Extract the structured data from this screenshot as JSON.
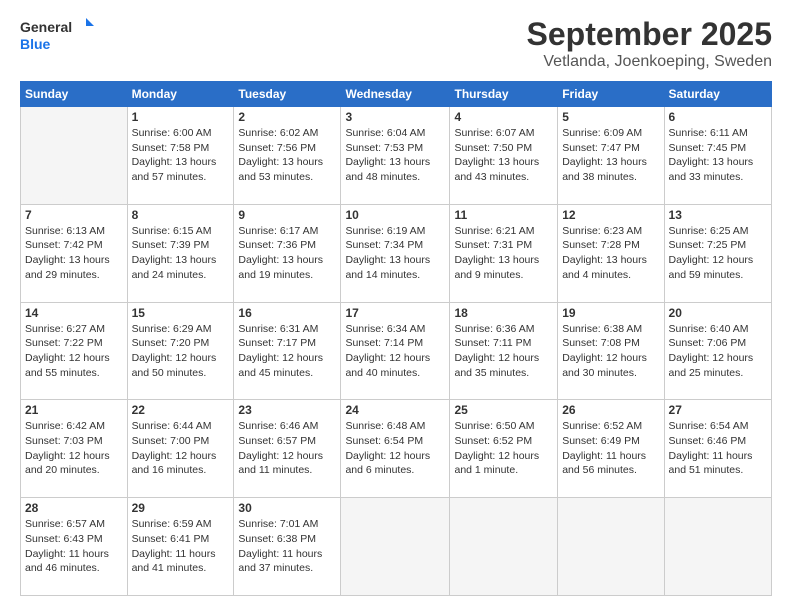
{
  "logo": {
    "line1": "General",
    "line2": "Blue"
  },
  "title": "September 2025",
  "subtitle": "Vetlanda, Joenkoeping, Sweden",
  "days_header": [
    "Sunday",
    "Monday",
    "Tuesday",
    "Wednesday",
    "Thursday",
    "Friday",
    "Saturday"
  ],
  "weeks": [
    [
      {
        "day": "",
        "sunrise": "",
        "sunset": "",
        "daylight": ""
      },
      {
        "day": "1",
        "sunrise": "Sunrise: 6:00 AM",
        "sunset": "Sunset: 7:58 PM",
        "daylight": "Daylight: 13 hours and 57 minutes."
      },
      {
        "day": "2",
        "sunrise": "Sunrise: 6:02 AM",
        "sunset": "Sunset: 7:56 PM",
        "daylight": "Daylight: 13 hours and 53 minutes."
      },
      {
        "day": "3",
        "sunrise": "Sunrise: 6:04 AM",
        "sunset": "Sunset: 7:53 PM",
        "daylight": "Daylight: 13 hours and 48 minutes."
      },
      {
        "day": "4",
        "sunrise": "Sunrise: 6:07 AM",
        "sunset": "Sunset: 7:50 PM",
        "daylight": "Daylight: 13 hours and 43 minutes."
      },
      {
        "day": "5",
        "sunrise": "Sunrise: 6:09 AM",
        "sunset": "Sunset: 7:47 PM",
        "daylight": "Daylight: 13 hours and 38 minutes."
      },
      {
        "day": "6",
        "sunrise": "Sunrise: 6:11 AM",
        "sunset": "Sunset: 7:45 PM",
        "daylight": "Daylight: 13 hours and 33 minutes."
      }
    ],
    [
      {
        "day": "7",
        "sunrise": "Sunrise: 6:13 AM",
        "sunset": "Sunset: 7:42 PM",
        "daylight": "Daylight: 13 hours and 29 minutes."
      },
      {
        "day": "8",
        "sunrise": "Sunrise: 6:15 AM",
        "sunset": "Sunset: 7:39 PM",
        "daylight": "Daylight: 13 hours and 24 minutes."
      },
      {
        "day": "9",
        "sunrise": "Sunrise: 6:17 AM",
        "sunset": "Sunset: 7:36 PM",
        "daylight": "Daylight: 13 hours and 19 minutes."
      },
      {
        "day": "10",
        "sunrise": "Sunrise: 6:19 AM",
        "sunset": "Sunset: 7:34 PM",
        "daylight": "Daylight: 13 hours and 14 minutes."
      },
      {
        "day": "11",
        "sunrise": "Sunrise: 6:21 AM",
        "sunset": "Sunset: 7:31 PM",
        "daylight": "Daylight: 13 hours and 9 minutes."
      },
      {
        "day": "12",
        "sunrise": "Sunrise: 6:23 AM",
        "sunset": "Sunset: 7:28 PM",
        "daylight": "Daylight: 13 hours and 4 minutes."
      },
      {
        "day": "13",
        "sunrise": "Sunrise: 6:25 AM",
        "sunset": "Sunset: 7:25 PM",
        "daylight": "Daylight: 12 hours and 59 minutes."
      }
    ],
    [
      {
        "day": "14",
        "sunrise": "Sunrise: 6:27 AM",
        "sunset": "Sunset: 7:22 PM",
        "daylight": "Daylight: 12 hours and 55 minutes."
      },
      {
        "day": "15",
        "sunrise": "Sunrise: 6:29 AM",
        "sunset": "Sunset: 7:20 PM",
        "daylight": "Daylight: 12 hours and 50 minutes."
      },
      {
        "day": "16",
        "sunrise": "Sunrise: 6:31 AM",
        "sunset": "Sunset: 7:17 PM",
        "daylight": "Daylight: 12 hours and 45 minutes."
      },
      {
        "day": "17",
        "sunrise": "Sunrise: 6:34 AM",
        "sunset": "Sunset: 7:14 PM",
        "daylight": "Daylight: 12 hours and 40 minutes."
      },
      {
        "day": "18",
        "sunrise": "Sunrise: 6:36 AM",
        "sunset": "Sunset: 7:11 PM",
        "daylight": "Daylight: 12 hours and 35 minutes."
      },
      {
        "day": "19",
        "sunrise": "Sunrise: 6:38 AM",
        "sunset": "Sunset: 7:08 PM",
        "daylight": "Daylight: 12 hours and 30 minutes."
      },
      {
        "day": "20",
        "sunrise": "Sunrise: 6:40 AM",
        "sunset": "Sunset: 7:06 PM",
        "daylight": "Daylight: 12 hours and 25 minutes."
      }
    ],
    [
      {
        "day": "21",
        "sunrise": "Sunrise: 6:42 AM",
        "sunset": "Sunset: 7:03 PM",
        "daylight": "Daylight: 12 hours and 20 minutes."
      },
      {
        "day": "22",
        "sunrise": "Sunrise: 6:44 AM",
        "sunset": "Sunset: 7:00 PM",
        "daylight": "Daylight: 12 hours and 16 minutes."
      },
      {
        "day": "23",
        "sunrise": "Sunrise: 6:46 AM",
        "sunset": "Sunset: 6:57 PM",
        "daylight": "Daylight: 12 hours and 11 minutes."
      },
      {
        "day": "24",
        "sunrise": "Sunrise: 6:48 AM",
        "sunset": "Sunset: 6:54 PM",
        "daylight": "Daylight: 12 hours and 6 minutes."
      },
      {
        "day": "25",
        "sunrise": "Sunrise: 6:50 AM",
        "sunset": "Sunset: 6:52 PM",
        "daylight": "Daylight: 12 hours and 1 minute."
      },
      {
        "day": "26",
        "sunrise": "Sunrise: 6:52 AM",
        "sunset": "Sunset: 6:49 PM",
        "daylight": "Daylight: 11 hours and 56 minutes."
      },
      {
        "day": "27",
        "sunrise": "Sunrise: 6:54 AM",
        "sunset": "Sunset: 6:46 PM",
        "daylight": "Daylight: 11 hours and 51 minutes."
      }
    ],
    [
      {
        "day": "28",
        "sunrise": "Sunrise: 6:57 AM",
        "sunset": "Sunset: 6:43 PM",
        "daylight": "Daylight: 11 hours and 46 minutes."
      },
      {
        "day": "29",
        "sunrise": "Sunrise: 6:59 AM",
        "sunset": "Sunset: 6:41 PM",
        "daylight": "Daylight: 11 hours and 41 minutes."
      },
      {
        "day": "30",
        "sunrise": "Sunrise: 7:01 AM",
        "sunset": "Sunset: 6:38 PM",
        "daylight": "Daylight: 11 hours and 37 minutes."
      },
      {
        "day": "",
        "sunrise": "",
        "sunset": "",
        "daylight": ""
      },
      {
        "day": "",
        "sunrise": "",
        "sunset": "",
        "daylight": ""
      },
      {
        "day": "",
        "sunrise": "",
        "sunset": "",
        "daylight": ""
      },
      {
        "day": "",
        "sunrise": "",
        "sunset": "",
        "daylight": ""
      }
    ]
  ]
}
